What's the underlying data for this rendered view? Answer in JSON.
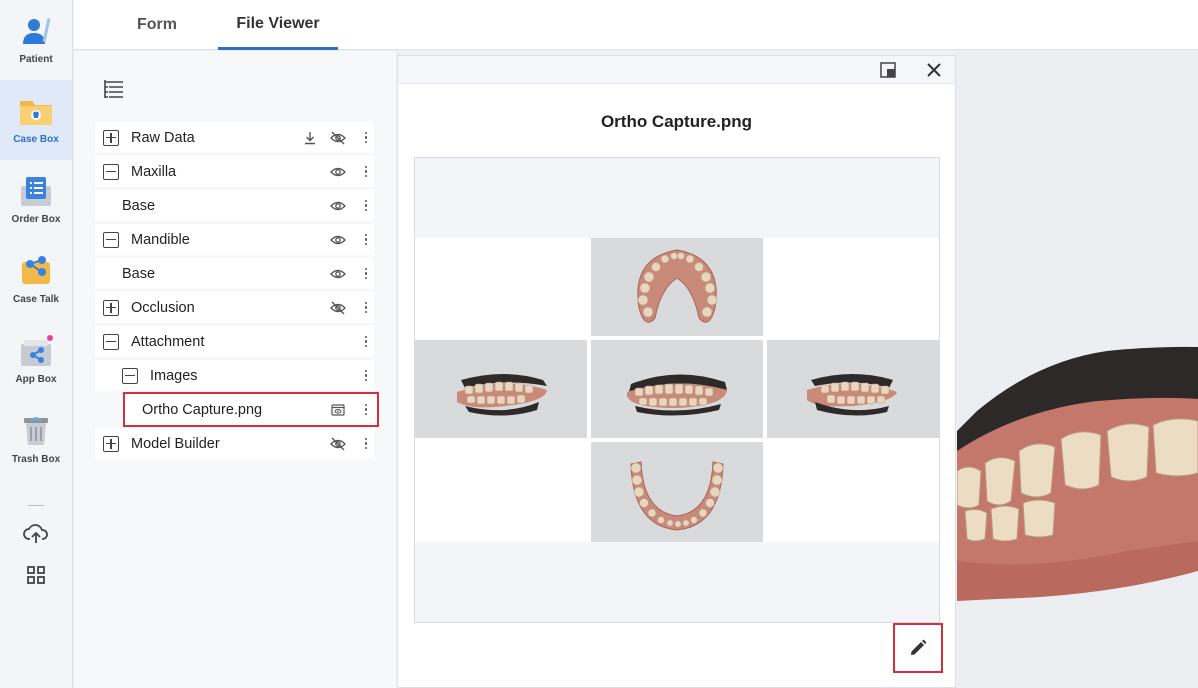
{
  "sidebar": {
    "items": [
      {
        "label": "Patient",
        "icon": "patient-icon",
        "active": false
      },
      {
        "label": "Case Box",
        "icon": "case-box-icon",
        "active": true
      },
      {
        "label": "Order Box",
        "icon": "order-box-icon",
        "active": false
      },
      {
        "label": "Case Talk",
        "icon": "case-talk-icon",
        "active": false
      },
      {
        "label": "App Box",
        "icon": "app-box-icon",
        "active": false
      },
      {
        "label": "Trash Box",
        "icon": "trash-box-icon",
        "active": false
      }
    ],
    "utilities": [
      "cloud-upload-icon",
      "grid-apps-icon"
    ]
  },
  "tabs": [
    {
      "label": "Form",
      "active": false
    },
    {
      "label": "File Viewer",
      "active": true
    }
  ],
  "tree": {
    "rows": [
      {
        "label": "Raw Data",
        "expander": "plus",
        "icons": [
          "download-icon",
          "eye-hidden-icon"
        ]
      },
      {
        "label": "Maxilla",
        "expander": "minus",
        "icons": [
          "eye-icon"
        ]
      },
      {
        "label": "Base",
        "expander": null,
        "icons": [
          "eye-icon"
        ]
      },
      {
        "label": "Mandible",
        "expander": "minus",
        "icons": [
          "eye-icon"
        ]
      },
      {
        "label": "Base",
        "expander": null,
        "icons": [
          "eye-icon"
        ]
      },
      {
        "label": "Occlusion",
        "expander": "plus",
        "icons": [
          "eye-hidden-icon"
        ]
      },
      {
        "label": "Attachment",
        "expander": "minus",
        "icons": []
      },
      {
        "label": "Images",
        "expander": "minus",
        "icons": []
      },
      {
        "label": "Ortho Capture.png",
        "expander": null,
        "icons": [
          "preview-icon"
        ],
        "selected": true
      },
      {
        "label": "Model Builder",
        "expander": "plus",
        "icons": [
          "eye-hidden-icon"
        ]
      }
    ]
  },
  "viewer": {
    "title": "Ortho Capture.png",
    "buttons": [
      "popout-icon",
      "close-icon",
      "pencil-edit-icon"
    ],
    "image_cells": [
      "upper-arch-occlusal",
      "right-buccal",
      "frontal",
      "left-buccal",
      "lower-arch-occlusal"
    ]
  },
  "colors": {
    "accent": "#2a6fcf",
    "highlight": "#d2313c",
    "panel_bg": "#f7f8fa"
  }
}
